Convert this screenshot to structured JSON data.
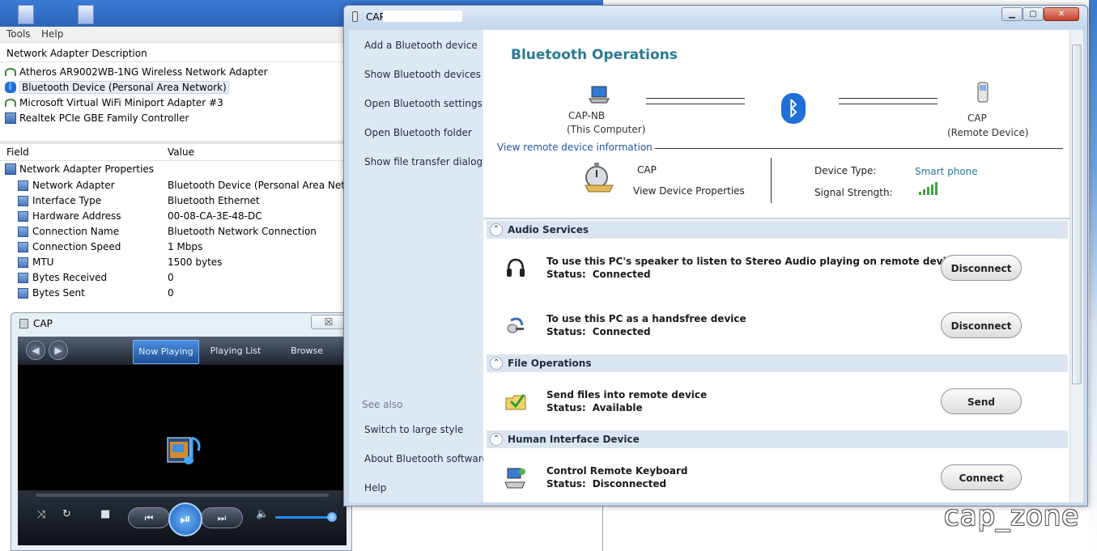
{
  "bg_window": {
    "menu": [
      "Tools",
      "Help"
    ],
    "adapter_list_header": "Network Adapter Description",
    "adapters": [
      {
        "label": "Atheros AR9002WB-1NG Wireless Network Adapter",
        "icon": "wifi-adapter-icon"
      },
      {
        "label": "Bluetooth Device (Personal Area Network)",
        "icon": "bluetooth-adapter-icon",
        "selected": true
      },
      {
        "label": "Microsoft Virtual WiFi Miniport Adapter #3",
        "icon": "wifi-adapter-icon"
      },
      {
        "label": "Realtek PCIe GBE Family Controller",
        "icon": "ethernet-adapter-icon"
      }
    ],
    "props_columns": {
      "field": "Field",
      "value": "Value"
    },
    "props_root": "Network Adapter Properties",
    "props": [
      {
        "field": "Network Adapter",
        "value": "Bluetooth Device (Personal Area Network)"
      },
      {
        "field": "Interface Type",
        "value": "Bluetooth Ethernet"
      },
      {
        "field": "Hardware Address",
        "value": "00-08-CA-3E-48-DC"
      },
      {
        "field": "Connection Name",
        "value": "Bluetooth Network Connection"
      },
      {
        "field": "Connection Speed",
        "value": "1 Mbps"
      },
      {
        "field": "MTU",
        "value": "1500 bytes"
      },
      {
        "field": "Bytes Received",
        "value": "0"
      },
      {
        "field": "Bytes Sent",
        "value": "0"
      }
    ]
  },
  "media_player": {
    "title": "CAP",
    "close_glyph": "☒",
    "tabs": [
      {
        "label": "Now Playing",
        "active": true
      },
      {
        "label": "Playing List",
        "active": false
      },
      {
        "label": "Browse",
        "active": false
      }
    ],
    "controls": {
      "shuffle": "⤨",
      "repeat": "↻",
      "stop": "■",
      "prev": "⏮",
      "play_pause": "⏯",
      "next": "⏭",
      "volume": "🔈"
    },
    "volume_level": 0.95
  },
  "bt_window": {
    "title": "CAP",
    "window_buttons": {
      "minimize": "▁",
      "maximize": "▢",
      "close": "✕"
    },
    "sidebar": {
      "links": [
        "Add a Bluetooth device",
        "Show Bluetooth devices",
        "Open Bluetooth settings",
        "Open Bluetooth folder",
        "Show file transfer dialog"
      ],
      "see_also": "See also",
      "see_also_links": [
        "Switch to large style",
        "About Bluetooth software",
        "Help"
      ]
    },
    "ops_title": "Bluetooth Operations",
    "local_device": {
      "name": "CAP-NB",
      "role": "(This Computer)"
    },
    "remote_device": {
      "name": "CAP",
      "role": "(Remote Device)"
    },
    "bt_symbol": "ᛒ",
    "view_remote_info": "View remote device information",
    "device_name": "CAP",
    "view_device_properties": "View Device Properties",
    "device_type_label": "Device Type:",
    "device_type_value": "Smart phone",
    "signal_strength_label": "Signal Strength:",
    "signal_bars": 5,
    "accent_color": "#2a7a93",
    "link_color": "#2156a5",
    "sections": [
      {
        "title": "Audio Services",
        "chevron": "⌃",
        "services": [
          {
            "icon": "headphones-icon",
            "title": "To use this PC's speaker to listen to Stereo Audio playing on remote device",
            "status_label": "Status:",
            "status": "Connected",
            "button": "Disconnect"
          },
          {
            "icon": "headset-icon",
            "title": "To use this PC as a handsfree device",
            "status_label": "Status:",
            "status": "Connected",
            "button": "Disconnect"
          }
        ]
      },
      {
        "title": "File Operations",
        "chevron": "⌃",
        "services": [
          {
            "icon": "folder-send-icon",
            "title": "Send files into remote device",
            "status_label": "Status:",
            "status": "Available",
            "button": "Send"
          }
        ]
      },
      {
        "title": "Human Interface Device",
        "chevron": "⌃",
        "services": [
          {
            "icon": "keyboard-icon",
            "title": "Control Remote Keyboard",
            "status_label": "Status:",
            "status": "Disconnected",
            "button": "Connect"
          }
        ]
      }
    ]
  },
  "watermark": "cap_zone"
}
